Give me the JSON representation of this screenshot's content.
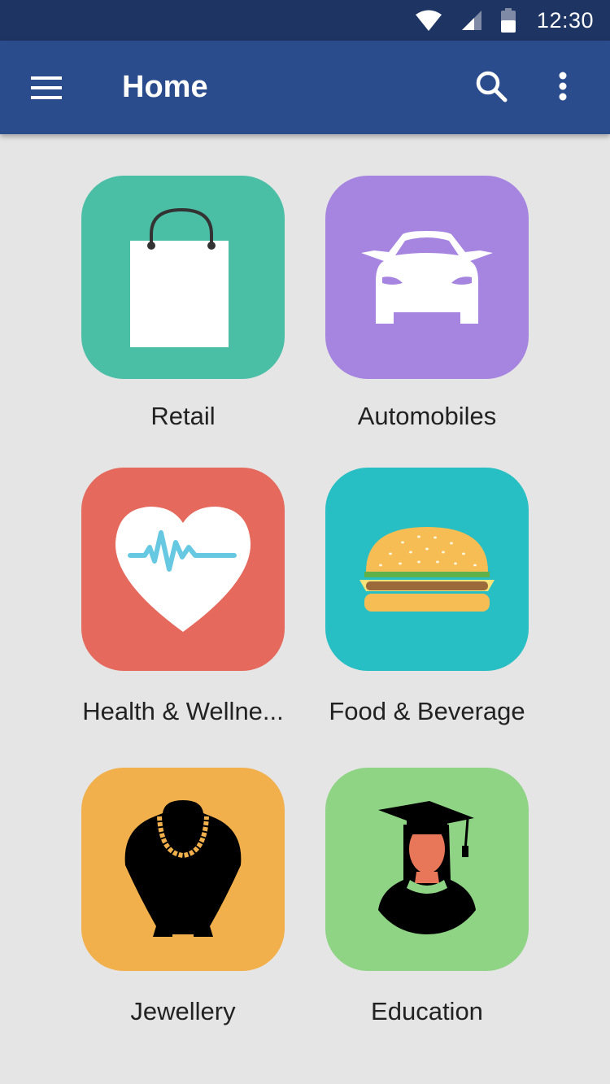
{
  "status_bar": {
    "time": "12:30"
  },
  "app_bar": {
    "title": "Home"
  },
  "categories": [
    {
      "label": "Retail",
      "color": "#4bbfa6",
      "icon": "shopping-bag-icon"
    },
    {
      "label": "Automobiles",
      "color": "#a685e0",
      "icon": "car-icon"
    },
    {
      "label": "Health & Wellne...",
      "color": "#e5695c",
      "icon": "heart-pulse-icon"
    },
    {
      "label": "Food & Beverage",
      "color": "#27bfc3",
      "icon": "burger-icon"
    },
    {
      "label": "Jewellery",
      "color": "#f2b04d",
      "icon": "necklace-icon"
    },
    {
      "label": "Education",
      "color": "#8fd485",
      "icon": "graduate-icon"
    }
  ],
  "colors": {
    "status_bar": "#1e3564",
    "app_bar": "#2b4c8c",
    "background": "#e5e5e5"
  }
}
